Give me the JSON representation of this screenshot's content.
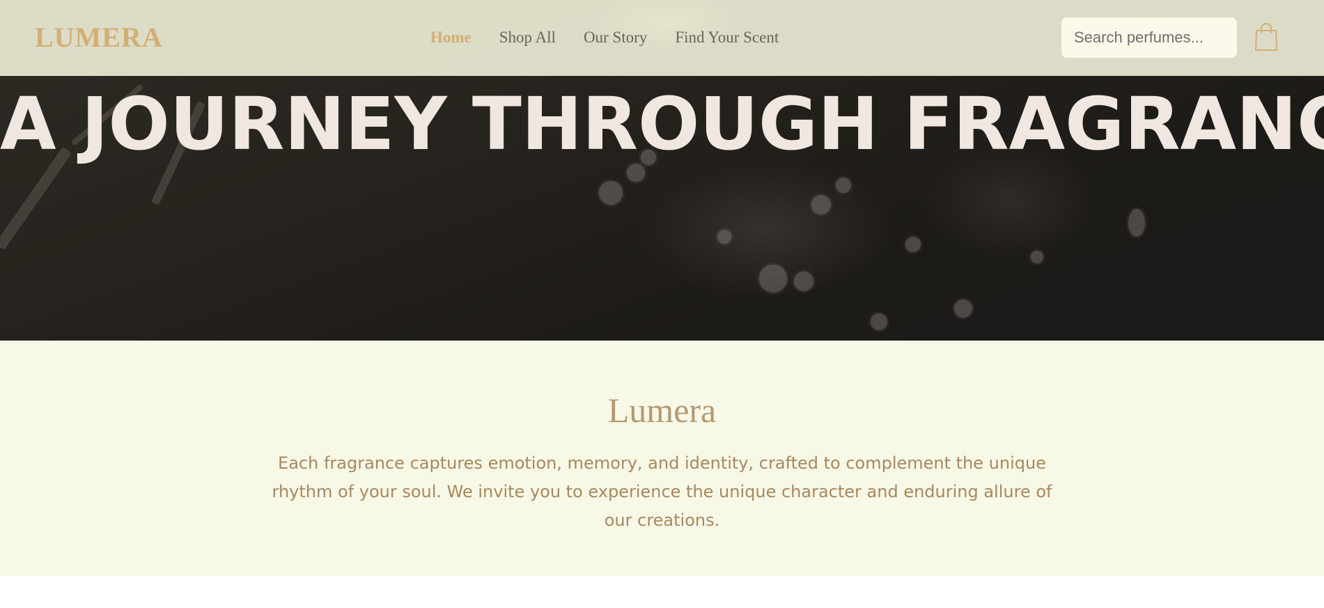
{
  "header": {
    "logo": "LUMERA",
    "nav": [
      "Home",
      "Shop All",
      "Our Story",
      "Find Your Scent"
    ],
    "active_nav": "Home",
    "search_placeholder": "Search perfumes..."
  },
  "hero": {
    "title": "A JOURNEY THROUGH FRAGRANCE"
  },
  "about": {
    "heading": "Lumera",
    "body": "Each fragrance captures emotion, memory, and identity, crafted to complement the unique rhythm of your soul. We invite you to experience the unique character and enduring allure of our creations."
  },
  "colors": {
    "brand_gold": "#d2b075",
    "nav_text": "#6b6355",
    "about_background": "#f7f8e6",
    "heading": "#b39a73",
    "body_text": "#a8885f",
    "hero_title": "#f1e7e1"
  }
}
